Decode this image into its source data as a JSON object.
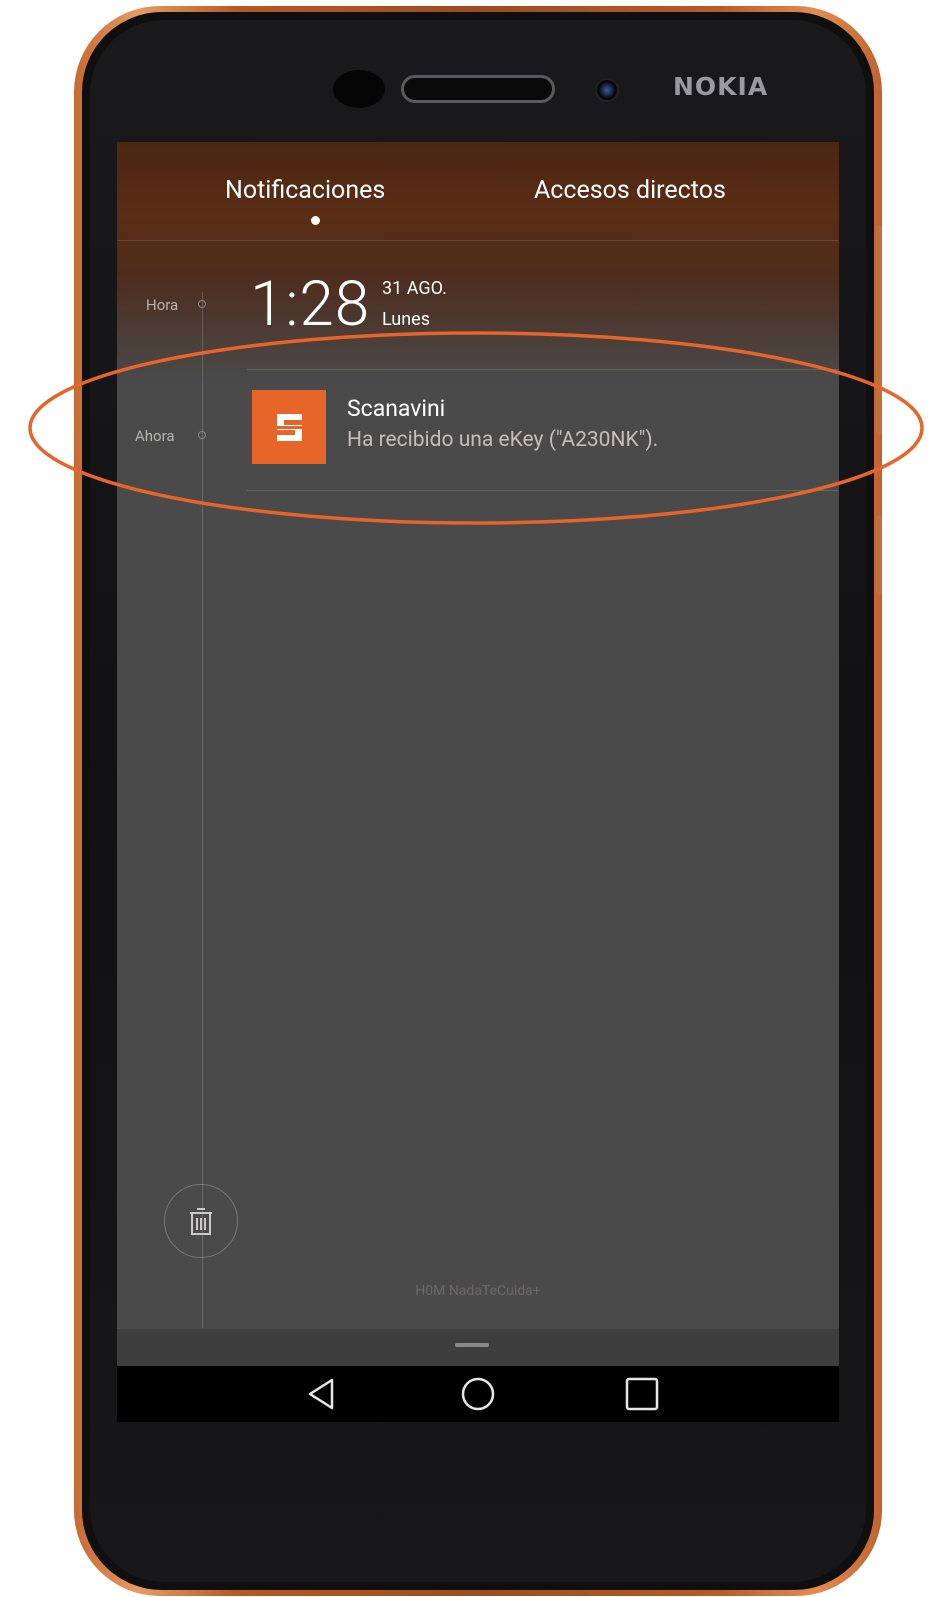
{
  "device": {
    "brand": "NOKIA"
  },
  "tabs": {
    "notifications_label": "Notificaciones",
    "shortcuts_label": "Accesos directos",
    "active": "Notificaciones"
  },
  "timeline": {
    "clock_label": "Hora",
    "notification_label": "Ahora"
  },
  "clock": {
    "time": "1:28",
    "date": "31 AGO.",
    "weekday": "Lunes"
  },
  "notifications": [
    {
      "app": "Scanavini",
      "message": "Ha recibido una eKey (\"A230NK\").",
      "icon": "scanavini-logo-icon",
      "icon_color": "#e8652a"
    }
  ],
  "footer": {
    "carrier": "H0M NadaTeCuida+",
    "clear_icon": "trash-icon"
  },
  "navigation": {
    "back_icon": "back-triangle-icon",
    "home_icon": "home-circle-icon",
    "recents_icon": "recents-square-icon"
  },
  "colors": {
    "highlight": "#e8652a",
    "accent": "#e8652a",
    "phone_trim": "#c56a32"
  }
}
